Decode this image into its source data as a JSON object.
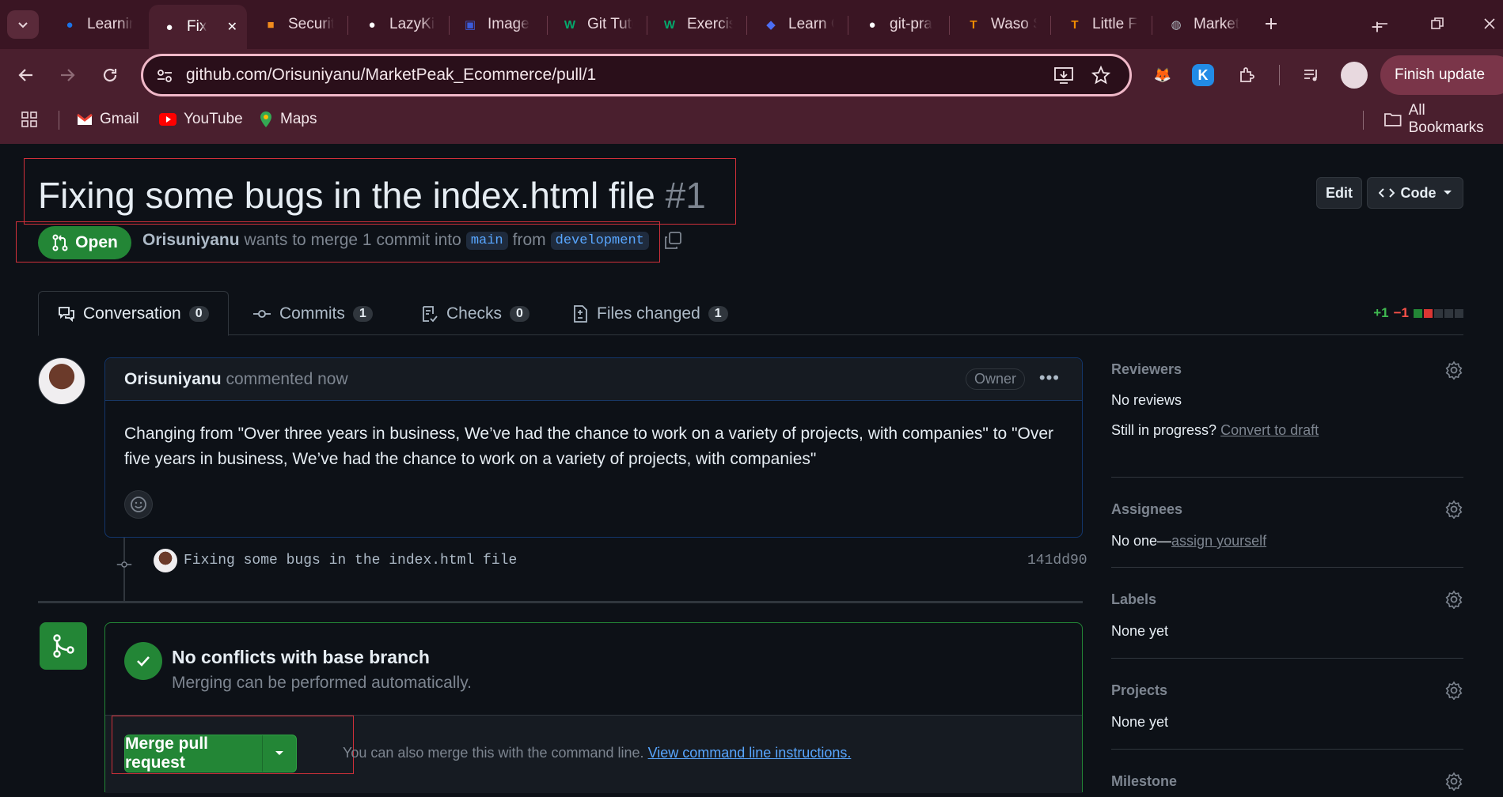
{
  "browser": {
    "tabs": [
      {
        "label": "Learnin",
        "icon": "learning-tab-icon",
        "color": "#1a73e8"
      },
      {
        "label": "Fix",
        "icon": "github-icon",
        "color": "#ffffff",
        "active": true
      },
      {
        "label": "Securit",
        "icon": "security-tab-icon",
        "color": "#f28c1e"
      },
      {
        "label": "LazyKic",
        "icon": "github-icon",
        "color": "#ffffff"
      },
      {
        "label": "Image",
        "icon": "image-tab-icon",
        "color": "#3b5bdb"
      },
      {
        "label": "Git Tuto",
        "icon": "w3schools-icon",
        "color": "#04aa6d"
      },
      {
        "label": "Exercis",
        "icon": "w3schools-icon",
        "color": "#04aa6d"
      },
      {
        "label": "Learn C",
        "icon": "learn-tab-icon",
        "color": "#4c6ef5"
      },
      {
        "label": "git-pra",
        "icon": "github-icon",
        "color": "#ffffff"
      },
      {
        "label": "Waso S",
        "icon": "t-letter-icon",
        "color": "#f08c00"
      },
      {
        "label": "Little Fa",
        "icon": "t-letter-icon",
        "color": "#f08c00"
      },
      {
        "label": "Market",
        "icon": "globe-icon",
        "color": "#adb5bd"
      }
    ],
    "url": "github.com/Orisuniyanu/MarketPeak_Ecommerce/pull/1",
    "finish_update": "Finish update",
    "bookmarks": [
      {
        "label": "Gmail",
        "icon": "gmail-icon"
      },
      {
        "label": "YouTube",
        "icon": "youtube-icon"
      },
      {
        "label": "Maps",
        "icon": "maps-icon"
      }
    ],
    "all_bookmarks": "All Bookmarks"
  },
  "pr": {
    "title": "Fixing some bugs in the index.html file",
    "number": "#1",
    "edit_label": "Edit",
    "code_label": "Code",
    "state": "Open",
    "author": "Orisuniyanu",
    "merge_text_1": "wants to merge 1 commit into",
    "base_branch": "main",
    "merge_text_2": "from",
    "head_branch": "development",
    "tabs": [
      {
        "label": "Conversation",
        "count": "0"
      },
      {
        "label": "Commits",
        "count": "1"
      },
      {
        "label": "Checks",
        "count": "0"
      },
      {
        "label": "Files changed",
        "count": "1"
      }
    ],
    "additions": "+1",
    "deletions": "−1"
  },
  "comment": {
    "author": "Orisuniyanu",
    "time": "commented now",
    "badge": "Owner",
    "body": "Changing from \"Over three years in business, We’ve had the chance to work on a variety of projects, with companies\" to \"Over five years in business, We’ve had the chance to work on a variety of projects, with companies\""
  },
  "commit": {
    "message": "Fixing some bugs in the index.html file",
    "sha": "141dd90"
  },
  "merge": {
    "title": "No conflicts with base branch",
    "subtitle": "Merging can be performed automatically.",
    "button": "Merge pull request",
    "hint": "You can also merge this with the command line.",
    "hint_link": "View command line instructions."
  },
  "sidebar": {
    "reviewers": {
      "title": "Reviewers",
      "value": "No reviews",
      "prompt": "Still in progress?",
      "link": "Convert to draft"
    },
    "assignees": {
      "title": "Assignees",
      "value": "No one—",
      "link": "assign yourself"
    },
    "labels": {
      "title": "Labels",
      "value": "None yet"
    },
    "projects": {
      "title": "Projects",
      "value": "None yet"
    },
    "milestone": {
      "title": "Milestone"
    }
  },
  "colors": {
    "accent_green": "#238636",
    "link_blue": "#58a6ff",
    "chrome_bg": "#4a1f2e"
  }
}
